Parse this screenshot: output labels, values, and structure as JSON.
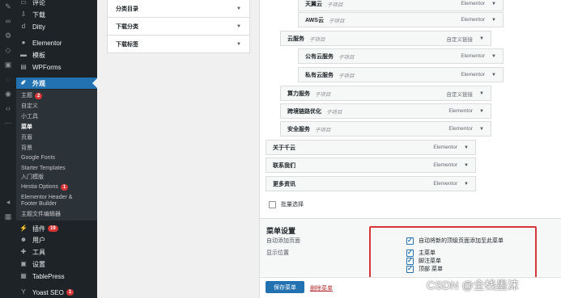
{
  "editor_strip": {
    "icons": [
      "pen-icon",
      "link-icon",
      "wrench-icon",
      "tag-icon",
      "image-icon",
      "comment-icon",
      "eye-icon",
      "code-icon",
      "more-icon"
    ]
  },
  "admin_menu": {
    "items": [
      {
        "label": "评论",
        "icon": "comment-icon"
      },
      {
        "label": "下载",
        "icon": "download-icon"
      },
      {
        "label": "Ditty",
        "icon": "ditty-icon"
      },
      {
        "label": "Elementor",
        "icon": "elementor-icon"
      },
      {
        "label": "模板",
        "icon": "folder-icon"
      },
      {
        "label": "WPForms",
        "icon": "forms-icon"
      },
      {
        "label": "外观",
        "icon": "brush-icon"
      }
    ],
    "submenu": [
      {
        "label": "主题",
        "badge": "2"
      },
      {
        "label": "自定义"
      },
      {
        "label": "小工具"
      },
      {
        "label": "菜单"
      },
      {
        "label": "页眉"
      },
      {
        "label": "背景"
      },
      {
        "label": "Google Fonts"
      },
      {
        "label": "Starter Templates"
      },
      {
        "label": "入门模版"
      },
      {
        "label": "Hestia Options",
        "badge": "1"
      },
      {
        "label": "Elementor Header &"
      },
      {
        "label": "Footer Builder"
      },
      {
        "label": "主题文件编辑器"
      }
    ],
    "bottom_items": [
      {
        "label": "插件",
        "badge": "19",
        "icon": "plugin-icon"
      },
      {
        "label": "用户",
        "icon": "user-icon"
      },
      {
        "label": "工具",
        "icon": "tool-icon"
      },
      {
        "label": "设置",
        "icon": "settings-icon"
      },
      {
        "label": "TablePress",
        "icon": "table-icon"
      },
      {
        "label": "Yoast SEO",
        "badge": "1",
        "icon": "yoast-icon"
      }
    ]
  },
  "left_panel": {
    "accordions": [
      "分类目录",
      "下载分类",
      "下载标签"
    ]
  },
  "menu_items": [
    {
      "title": "天翼云",
      "sub": "子项目",
      "type": "Elementor"
    },
    {
      "title": "AWS云",
      "sub": "子项目",
      "type": "Elementor"
    },
    {
      "title": "云服务",
      "sub": "子项目",
      "type": "自定义链接"
    },
    {
      "title": "公有云服务",
      "sub": "子项目",
      "type": "Elementor"
    },
    {
      "title": "私有云服务",
      "sub": "子项目",
      "type": "Elementor"
    },
    {
      "title": "算力服务",
      "sub": "子项目",
      "type": "自定义链接"
    },
    {
      "title": "跨境链路优化",
      "sub": "子项目",
      "type": "Elementor"
    },
    {
      "title": "安全服务",
      "sub": "子项目",
      "type": "Elementor"
    },
    {
      "title": "关于千云",
      "sub": "",
      "type": "Elementor"
    },
    {
      "title": "联系我们",
      "sub": "",
      "type": "Elementor"
    },
    {
      "title": "更多资讯",
      "sub": "",
      "type": "Elementor"
    }
  ],
  "bulk_select": "批量选择",
  "settings": {
    "title": "菜单设置",
    "auto_add_label": "自动添加页面",
    "auto_add_option": "自动将新的顶级页面添加至此菜单",
    "display_location_label": "显示位置",
    "locations": [
      "主菜单",
      "脚注菜单",
      "顶部 菜单"
    ]
  },
  "actions": {
    "save": "保存菜单",
    "delete": "删除菜单"
  },
  "watermark": "CSDN @全栈墨沫"
}
